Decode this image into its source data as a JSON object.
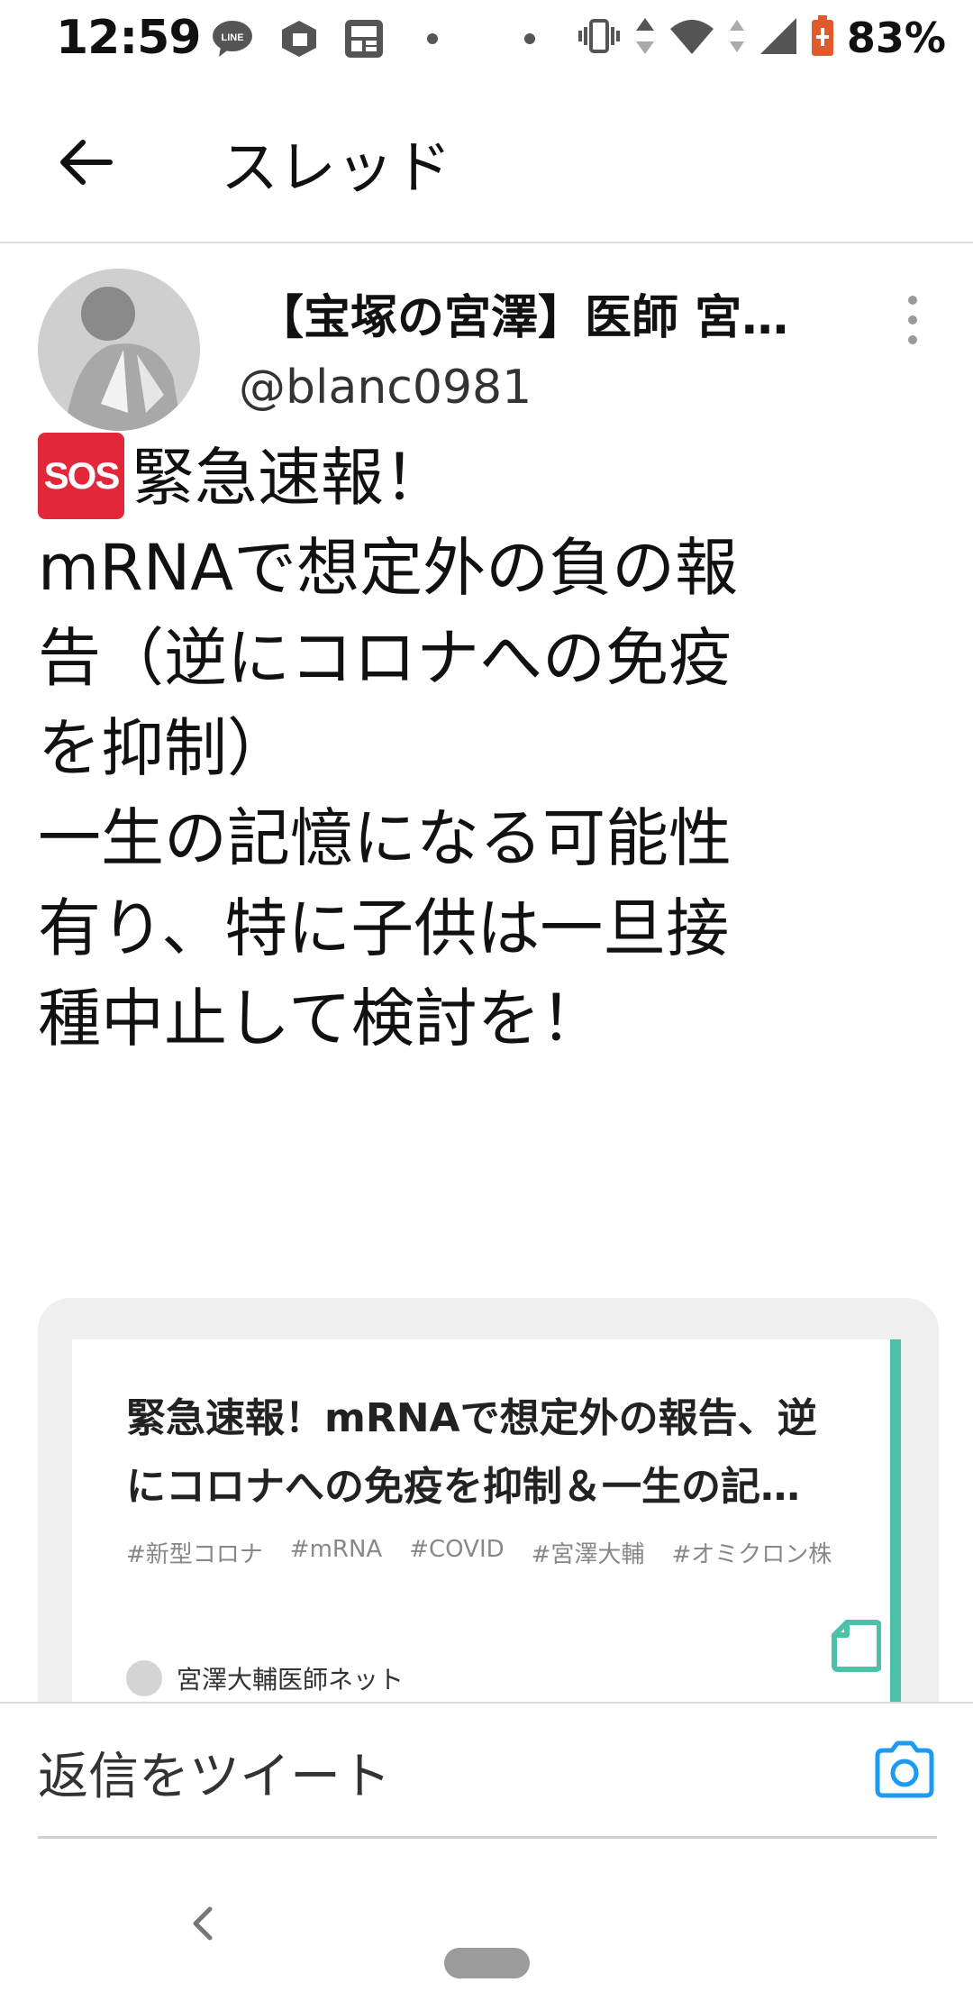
{
  "status_bar": {
    "time": "12:59",
    "battery_percent": "83%",
    "icons": [
      "line-icon",
      "mcafee-icon",
      "news-icon",
      "dot-icon",
      "dot-icon",
      "vibrate-icon",
      "data-arrows-icon",
      "wifi-icon",
      "signal-icon",
      "battery-icon"
    ]
  },
  "header": {
    "title": "スレッド",
    "back_icon": "arrow-left-icon"
  },
  "tweet": {
    "author_name": "【宝塚の宮澤】医師 宮…",
    "author_handle": "@blanc0981",
    "badge_text": "SOS",
    "body_lines": [
      "緊急速報！",
      "mRNAで想定外の負の報",
      "告（逆にコロナへの免疫",
      "を抑制）",
      "一生の記憶になる可能性",
      "有り、特に子供は一旦接",
      "種中止して検討を！"
    ]
  },
  "link_card": {
    "title_lines": [
      "緊急速報！mRNAで想定外の報告、逆",
      "にコロナへの免疫を抑制＆一生の記…"
    ],
    "tags": [
      "#新型コロナ",
      "#mRNA",
      "#COVID",
      "#宮澤大輔",
      "#オミクロン株"
    ],
    "author": "宮澤大輔医師ネット",
    "accent_color": "#4cc1a8"
  },
  "reply": {
    "placeholder": "返信をツイート",
    "camera_color": "#1d9bf0"
  },
  "colors": {
    "sos_red": "#e2273b",
    "divider": "#dddddd"
  }
}
